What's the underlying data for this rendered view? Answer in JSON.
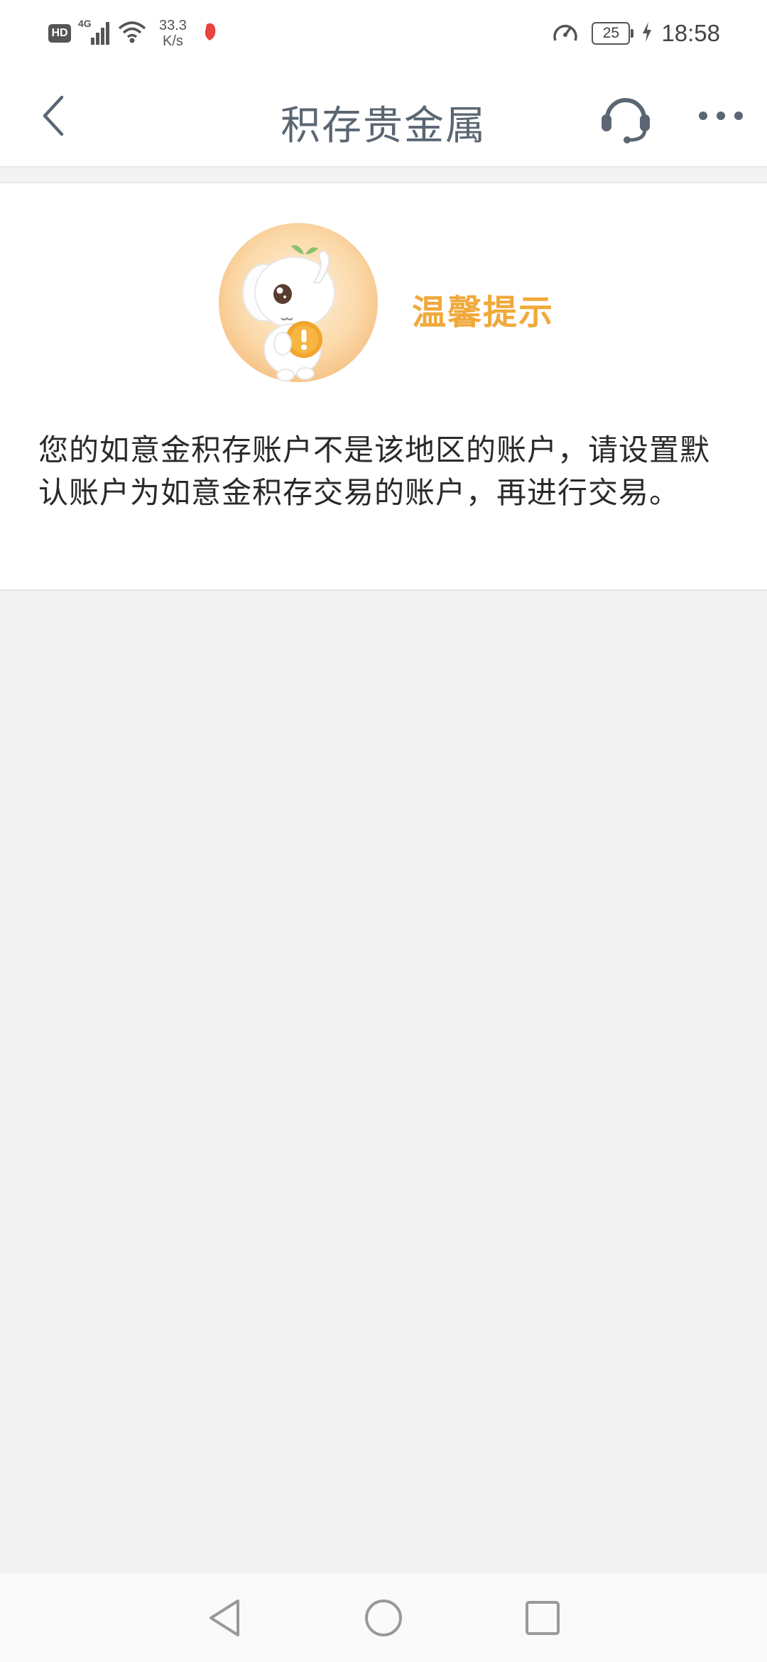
{
  "status_bar": {
    "hd": "HD",
    "network": "4G",
    "speed_value": "33.3",
    "speed_unit": "K/s",
    "battery": "25",
    "time": "18:58"
  },
  "header": {
    "title": "积存贵金属",
    "back_icon": "chevron-left-icon",
    "service_icon": "headset-icon",
    "more_icon": "more-dots-icon"
  },
  "notice": {
    "title": "温馨提示",
    "message": "您的如意金积存账户不是该地区的账户，请设置默认账户为如意金积存交易的账户，再进行交易。",
    "accent_color": "#f0a93b"
  },
  "system_nav": {
    "back_icon": "triangle-back-icon",
    "home_icon": "circle-home-icon",
    "recents_icon": "square-recents-icon"
  }
}
